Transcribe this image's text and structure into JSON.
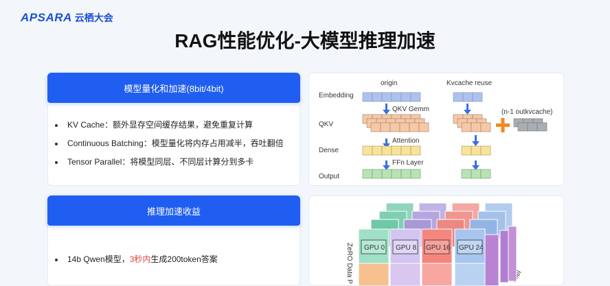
{
  "logo": {
    "brand": "APSARA",
    "suffix": "云栖大会"
  },
  "title": "RAG性能优化-大模型推理加速",
  "card1": {
    "header": "模型量化和加速(8bit/4bit)",
    "bullets": [
      "KV Cache：额外显存空间缓存结果，避免重复计算",
      "Continuous Batching：模型量化将内存占用减半，吞吐翻倍",
      "Tensor Parallel：将模型同层、不同层计算分到多卡"
    ]
  },
  "card2": {
    "header": "推理加速收益",
    "bullet1": {
      "prefix": "14b Qwen模型，",
      "highlight": "3秒内",
      "suffix": "生成200token答案"
    }
  },
  "diagram1": {
    "col_origin": "origin",
    "col_kvcache": "Kvcache reuse",
    "row_labels": [
      "Embedding",
      "QKV",
      "Dense",
      "Output"
    ],
    "step_labels": [
      "QKV Gemm",
      "Attention",
      "FFn Layer"
    ],
    "extra_label": "(n-1 outkvcache)",
    "colors": {
      "embedding": "#aec2ef",
      "qkv": "#f5c9a8",
      "dense": "#f8e39a",
      "output": "#b7e3b6",
      "plus": "#f08a24"
    }
  },
  "diagram2": {
    "gpu_labels": [
      "GPU 0",
      "GPU 8",
      "GPU 16",
      "GPU 24"
    ],
    "axis_label_left": "ZeRO Data P",
    "axis_label_right": "allel"
  }
}
